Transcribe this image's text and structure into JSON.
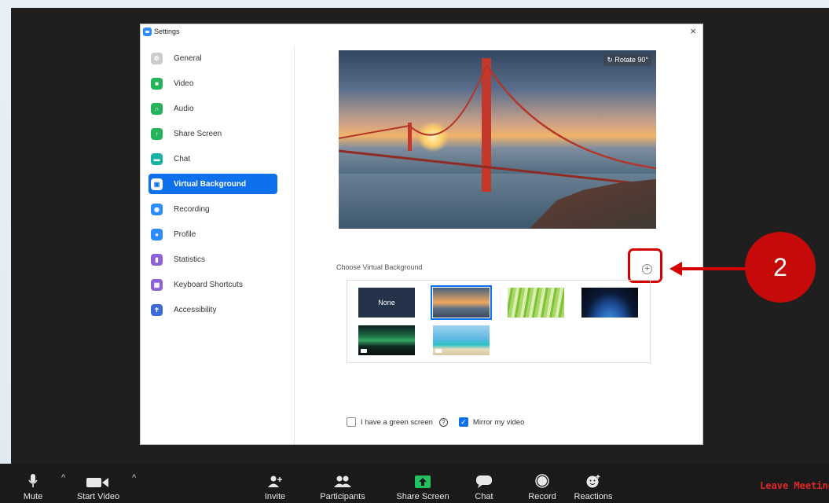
{
  "window": {
    "title": "Settings",
    "close_glyph": "×"
  },
  "sidebar": {
    "items": [
      {
        "label": "General",
        "icon": "gear-icon",
        "color": "#cccccc",
        "active": false
      },
      {
        "label": "Video",
        "icon": "video-icon",
        "color": "#23b35a",
        "active": false
      },
      {
        "label": "Audio",
        "icon": "headphones-icon",
        "color": "#23b35a",
        "active": false
      },
      {
        "label": "Share Screen",
        "icon": "share-screen-icon",
        "color": "#23b35a",
        "active": false
      },
      {
        "label": "Chat",
        "icon": "chat-icon",
        "color": "#19b3a4",
        "active": false
      },
      {
        "label": "Virtual Background",
        "icon": "virtual-background-icon",
        "color": "#0e71eb",
        "active": true
      },
      {
        "label": "Recording",
        "icon": "recording-icon",
        "color": "#2d8cff",
        "active": false
      },
      {
        "label": "Profile",
        "icon": "profile-icon",
        "color": "#2d8cff",
        "active": false
      },
      {
        "label": "Statistics",
        "icon": "statistics-icon",
        "color": "#8f60d6",
        "active": false
      },
      {
        "label": "Keyboard Shortcuts",
        "icon": "keyboard-icon",
        "color": "#8f60d6",
        "active": false
      },
      {
        "label": "Accessibility",
        "icon": "accessibility-icon",
        "color": "#3c6bd8",
        "active": false
      }
    ]
  },
  "preview": {
    "rotate_label": "Rotate 90°"
  },
  "backgrounds": {
    "heading": "Choose Virtual Background",
    "add_glyph": "+",
    "none_label": "None",
    "selected_index": 1
  },
  "options": {
    "green_screen_label": "I have a green screen",
    "green_screen_checked": false,
    "help_glyph": "?",
    "mirror_label": "Mirror my video",
    "mirror_checked": true
  },
  "annotation": {
    "step_number": "2"
  },
  "toolbar": {
    "mute": "Mute",
    "start_video": "Start Video",
    "invite": "Invite",
    "participants": "Participants",
    "share_screen": "Share Screen",
    "chat": "Chat",
    "record": "Record",
    "reactions": "Reactions",
    "leave": "Leave Meeting",
    "caret_glyph": "^"
  }
}
